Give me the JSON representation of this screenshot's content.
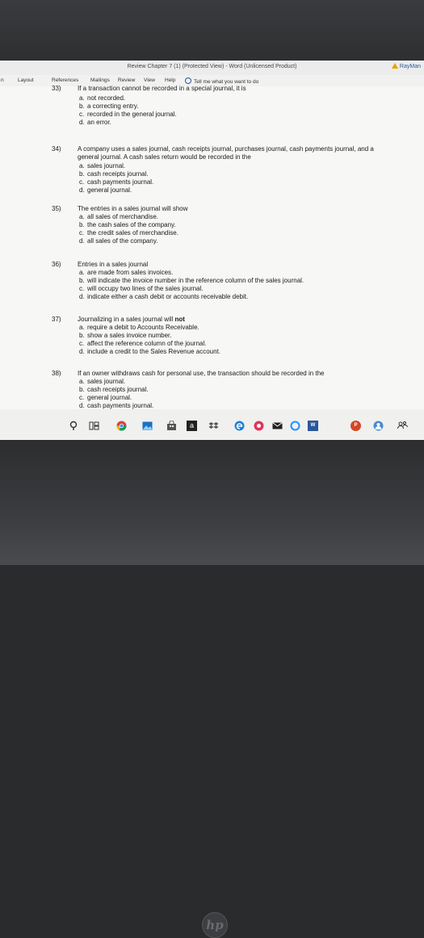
{
  "window": {
    "title": "Review Chapter 7 (1) (Protected View)  -  Word (Unlicensed Product)",
    "user": "RayMan"
  },
  "ribbon": {
    "tabs": [
      "n",
      "Layout",
      "References",
      "Mailings",
      "Review",
      "View",
      "Help"
    ],
    "tell_me": "Tell me what you want to do"
  },
  "questions": [
    {
      "number": "33)",
      "text": "If a transaction cannot be recorded in a special journal, it is",
      "options": [
        {
          "letter": "a.",
          "text": "not recorded."
        },
        {
          "letter": "b.",
          "text": "a correcting entry."
        },
        {
          "letter": "c.",
          "text": "recorded in the general journal."
        },
        {
          "letter": "d.",
          "text": "an error."
        }
      ]
    },
    {
      "number": "34)",
      "text": "A company uses a sales journal, cash receipts journal, purchases journal, cash payments journal, and a general journal. A cash sales return would be recorded in the",
      "options": [
        {
          "letter": "a.",
          "text": "sales journal."
        },
        {
          "letter": "b.",
          "text": "cash receipts journal."
        },
        {
          "letter": "c.",
          "text": "cash payments journal."
        },
        {
          "letter": "d.",
          "text": "general journal."
        }
      ]
    },
    {
      "number": "35)",
      "text": "The entries in a sales journal will show",
      "options": [
        {
          "letter": "a.",
          "text": "all sales of merchandise."
        },
        {
          "letter": "b.",
          "text": "the cash sales of the company."
        },
        {
          "letter": "c.",
          "text": "the credit sales of merchandise."
        },
        {
          "letter": "d.",
          "text": "all sales of the company."
        }
      ]
    },
    {
      "number": "36)",
      "text": "Entries in a sales journal",
      "options": [
        {
          "letter": "a.",
          "text": "are made from sales invoices."
        },
        {
          "letter": "b.",
          "text": "will indicate the invoice number in the reference column of the sales journal."
        },
        {
          "letter": "c.",
          "text": "will occupy two lines of the sales journal."
        },
        {
          "letter": "d.",
          "text": "indicate either a cash debit or accounts receivable debit."
        }
      ]
    },
    {
      "number": "37)",
      "text_before": "Journalizing in a sales journal will",
      "text_bold": "not",
      "options": [
        {
          "letter": "a.",
          "text": "require a debit to Accounts Receivable."
        },
        {
          "letter": "b.",
          "text": "show a sales invoice number."
        },
        {
          "letter": "c.",
          "text": "affect the reference column of the journal."
        },
        {
          "letter": "d.",
          "text": "include a credit to the Sales Revenue account."
        }
      ]
    },
    {
      "number": "38)",
      "text": "If an owner withdraws cash for personal use, the transaction should be recorded in the",
      "options": [
        {
          "letter": "a.",
          "text": "sales journal."
        },
        {
          "letter": "b.",
          "text": "cash receipts journal."
        },
        {
          "letter": "c.",
          "text": "general journal."
        },
        {
          "letter": "d.",
          "text": "cash payments journal."
        }
      ]
    }
  ],
  "taskbar": {
    "store_letter": "a",
    "icons": [
      "search-icon",
      "task-view-icon",
      "chrome-icon",
      "photos-icon",
      "store-bag-icon",
      "amazon-icon",
      "dropbox-icon",
      "edge-icon",
      "itunes-icon",
      "mail-icon",
      "cortana-icon",
      "word-icon",
      "powerpoint-icon",
      "chrome-user-icon",
      "people-icon"
    ],
    "colors": {
      "chrome": "#4285f4",
      "edge": "#1e7fd8",
      "word": "#2b579a",
      "powerpoint": "#d24726",
      "cortana": "#1e90ff",
      "itunes": "#e0355a",
      "amazon": "#222222"
    }
  },
  "device": {
    "logo": "hp"
  }
}
